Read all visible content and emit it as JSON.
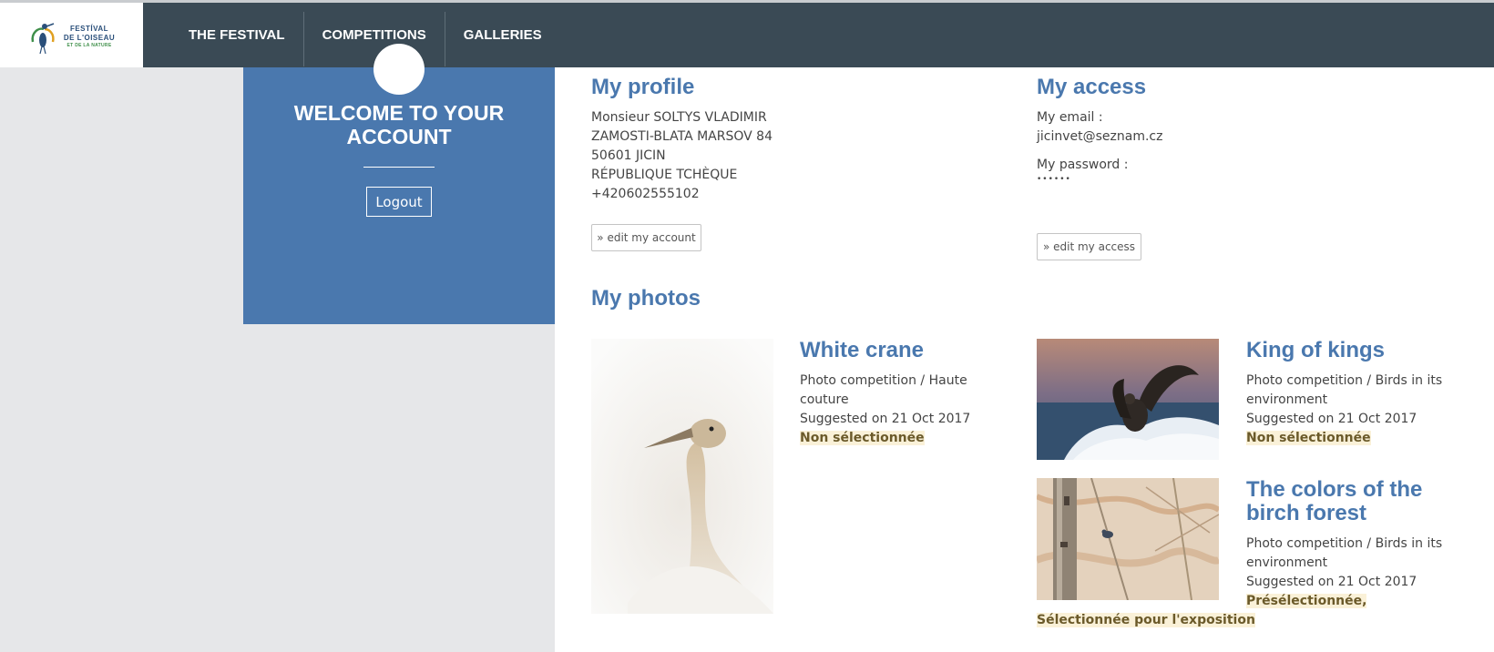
{
  "header": {
    "logo": {
      "line1": "FESTÍVAL",
      "line2": "DE L'OISEAU",
      "line3": "ET DE LA NATURE"
    },
    "nav": [
      "THE FESTIVAL",
      "COMPETITIONS",
      "GALLERIES"
    ]
  },
  "welcome": {
    "title": "WELCOME TO YOUR ACCOUNT",
    "logout_label": "Logout"
  },
  "profile": {
    "title": "My profile",
    "lines": [
      "Monsieur SOLTYS VLADIMIR",
      "ZAMOSTI-BLATA MARSOV 84",
      "50601 JICIN",
      "RÉPUBLIQUE TCHÈQUE",
      "+420602555102"
    ],
    "edit_label": "» edit my account"
  },
  "access": {
    "title": "My access",
    "email_label": "My email :",
    "email_value": "jicinvet@seznam.cz",
    "password_label": "My password :",
    "password_value": "••••••",
    "edit_label": "» edit my access"
  },
  "photos": {
    "title": "My photos",
    "items": [
      {
        "title": "White crane",
        "category": "Photo competition / Haute couture",
        "suggested": "Suggested on 21 Oct 2017",
        "status": "Non sélectionnée"
      },
      {
        "title": "King of kings",
        "category": "Photo competition / Birds in its environment",
        "suggested": "Suggested on 21 Oct 2017",
        "status": "Non sélectionnée"
      },
      {
        "title": "The colors of the birch forest",
        "category": "Photo competition / Birds in its environment",
        "suggested": "Suggested on 21 Oct 2017",
        "status": "Présélectionnée, Sélectionnée pour l'exposition"
      }
    ]
  },
  "colors": {
    "header_bg": "#3a4a55",
    "accent_blue": "#4a78ae",
    "status_bg": "#faf1d8"
  }
}
